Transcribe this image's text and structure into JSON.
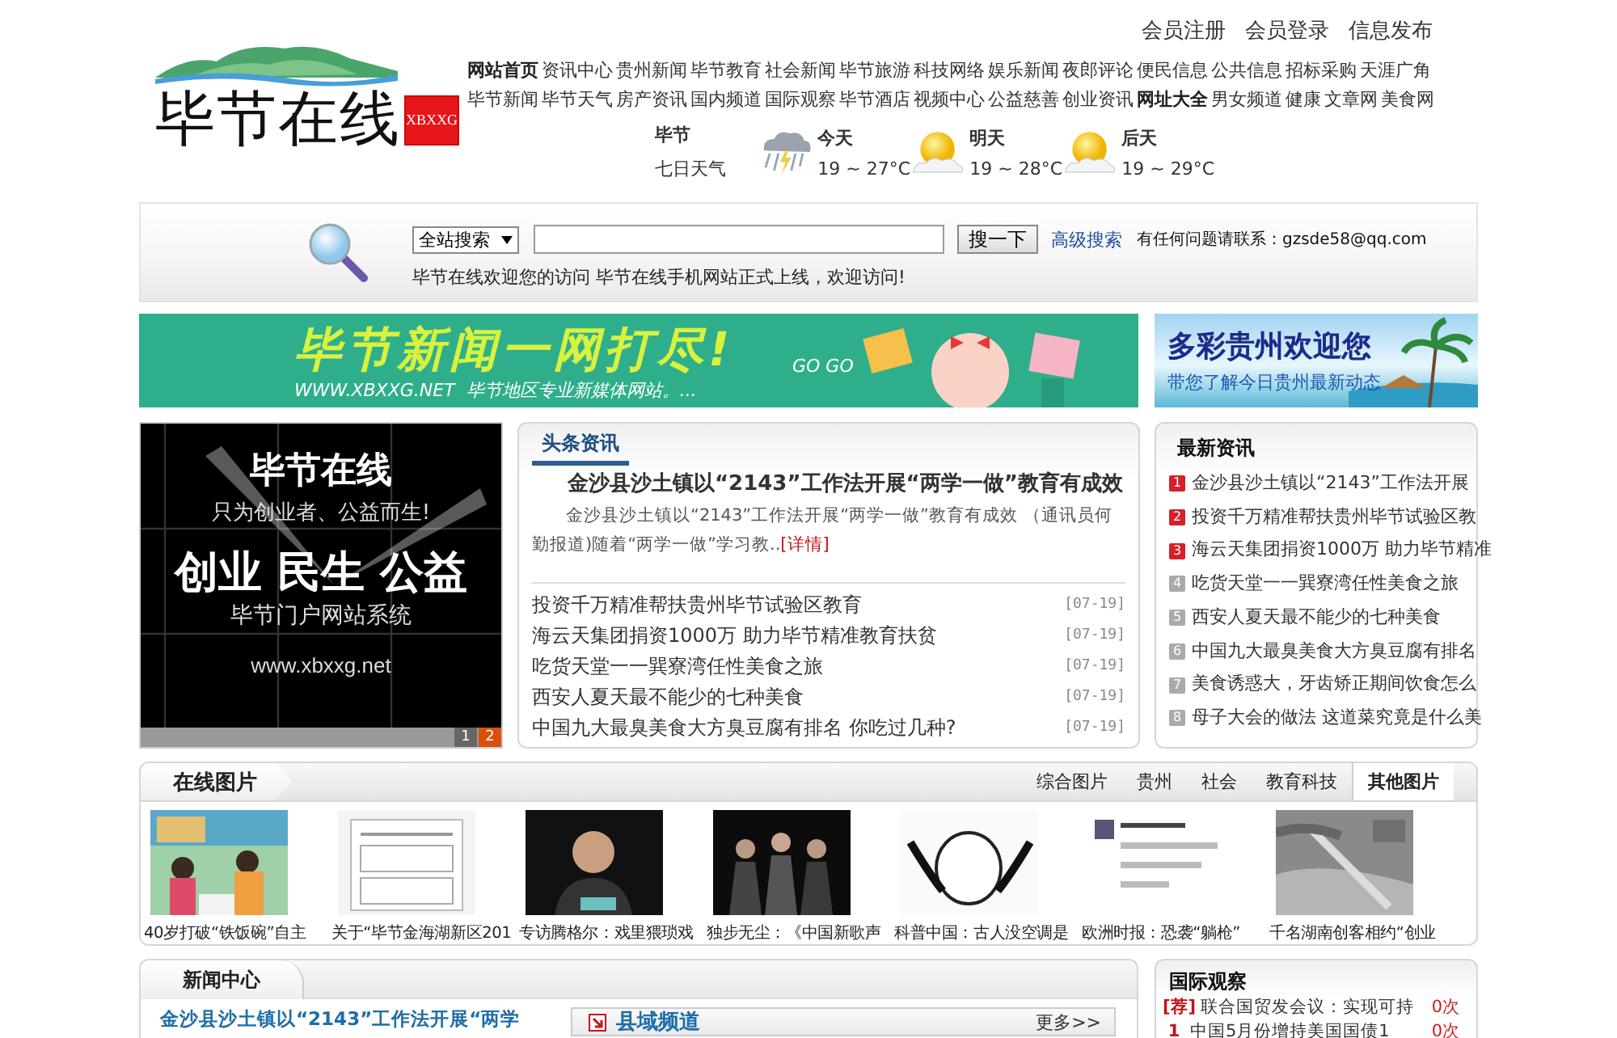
{
  "header": {
    "logo": {
      "title": "毕节在线",
      "badge": "XBXXG"
    },
    "user_links": [
      "会员注册",
      "会员登录",
      "信息发布"
    ],
    "nav_rows": [
      {
        "items": [
          {
            "label": "网站首页",
            "emphasized": true
          },
          {
            "label": "资讯中心",
            "emphasized": false
          },
          {
            "label": "贵州新闻",
            "emphasized": false
          },
          {
            "label": "毕节教育",
            "emphasized": false
          },
          {
            "label": "社会新闻",
            "emphasized": false
          },
          {
            "label": "毕节旅游",
            "emphasized": false
          },
          {
            "label": "科技网络",
            "emphasized": false
          },
          {
            "label": "娱乐新闻",
            "emphasized": false
          },
          {
            "label": "夜郎评论",
            "emphasized": false
          },
          {
            "label": "便民信息",
            "emphasized": false
          },
          {
            "label": "公共信息",
            "emphasized": false
          },
          {
            "label": "招标采购",
            "emphasized": false
          },
          {
            "label": "天涯广角",
            "emphasized": false
          }
        ]
      },
      {
        "items": [
          {
            "label": "毕节新闻",
            "emphasized": false
          },
          {
            "label": "毕节天气",
            "emphasized": false
          },
          {
            "label": "房产资讯",
            "emphasized": false
          },
          {
            "label": "国内频道",
            "emphasized": false
          },
          {
            "label": "国际观察",
            "emphasized": false
          },
          {
            "label": "毕节酒店",
            "emphasized": false
          },
          {
            "label": "视频中心",
            "emphasized": false
          },
          {
            "label": "公益慈善",
            "emphasized": false
          },
          {
            "label": "创业资讯",
            "emphasized": false
          },
          {
            "label": "网址大全",
            "emphasized": true
          },
          {
            "label": "男女频道",
            "emphasized": false
          },
          {
            "label": "健康",
            "emphasized": false
          },
          {
            "label": "文章网",
            "emphasized": false
          },
          {
            "label": "美食网",
            "emphasized": false
          }
        ]
      }
    ],
    "weather": {
      "city": "毕节",
      "link": "七日天气",
      "days": [
        {
          "label": "今天",
          "temp": "19 ~ 27°C",
          "kind": "storm"
        },
        {
          "label": "明天",
          "temp": "19 ~ 28°C",
          "kind": "sunny"
        },
        {
          "label": "后天",
          "temp": "19 ~ 29°C",
          "kind": "sunny"
        }
      ]
    }
  },
  "search": {
    "scope": "全站搜索",
    "button": "搜一下",
    "advanced": "高级搜索",
    "contact": "有任何问题请联系：gzsde58@qq.com",
    "welcome": "毕节在线欢迎您的访问 毕节在线手机网站正式上线，欢迎访问!"
  },
  "banners": [
    {
      "title": "毕节新闻一网打尽!",
      "subtitle": "WWW.XBXXG.NET  毕节地区专业新媒体网站。...",
      "extra": "GO GO"
    },
    {
      "title": "多彩贵州欢迎您",
      "subtitle": "带您了解今日贵州最新动态"
    }
  ],
  "slider": {
    "title": "毕节在线",
    "slogan": "只为创业者、公益而生!",
    "headline": "创业 民生 公益",
    "subtitle": "毕节门户网站系统",
    "url": "www.xbxxg.net",
    "pages": [
      {
        "label": "1",
        "selected": false
      },
      {
        "label": "2",
        "selected": true
      }
    ]
  },
  "headlines": {
    "title": "头条资讯",
    "lead_title": "金沙县沙土镇以“2143”工作法开展“两学一做”教育有成效",
    "lead_summary": "金沙县沙土镇以“2143”工作法开展“两学一做”教育有成效 （通讯员何勤报道)随着“两学一做”学习教..",
    "more": "[详情]",
    "items": [
      {
        "title": "投资千万精准帮扶贵州毕节试验区教育",
        "date": "[07-19]"
      },
      {
        "title": "海云天集团捐资1000万 助力毕节精准教育扶贫",
        "date": "[07-19]"
      },
      {
        "title": "吃货天堂一一巽寮湾任性美食之旅",
        "date": "[07-19]"
      },
      {
        "title": "西安人夏天最不能少的七种美食",
        "date": "[07-19]"
      },
      {
        "title": "中国九大最臭美食大方臭豆腐有排名 你吃过几种?",
        "date": "[07-19]"
      }
    ]
  },
  "latest": {
    "title": "最新资讯",
    "items": [
      {
        "rank": "1",
        "hot": true,
        "title": "金沙县沙土镇以“2143”工作法开展"
      },
      {
        "rank": "2",
        "hot": true,
        "title": "投资千万精准帮扶贵州毕节试验区教"
      },
      {
        "rank": "3",
        "hot": true,
        "title": "海云天集团捐资1000万 助力毕节精准"
      },
      {
        "rank": "4",
        "hot": false,
        "title": "吃货天堂一一巽寮湾任性美食之旅"
      },
      {
        "rank": "5",
        "hot": false,
        "title": "西安人夏天最不能少的七种美食"
      },
      {
        "rank": "6",
        "hot": false,
        "title": "中国九大最臭美食大方臭豆腐有排名"
      },
      {
        "rank": "7",
        "hot": false,
        "title": "美食诱惑大，牙齿矫正期间饮食怎么"
      },
      {
        "rank": "8",
        "hot": false,
        "title": "母子大会的做法 这道菜究竟是什么美"
      }
    ]
  },
  "photos": {
    "title": "在线图片",
    "tabs": [
      {
        "label": "综合图片",
        "selected": false
      },
      {
        "label": "贵州",
        "selected": false
      },
      {
        "label": "社会",
        "selected": false
      },
      {
        "label": "教育科技",
        "selected": false
      },
      {
        "label": "其他图片",
        "selected": true
      }
    ],
    "items": [
      {
        "caption": "40岁打破“铁饭碗”自主"
      },
      {
        "caption": "关于“毕节金海湖新区201"
      },
      {
        "caption": "专访腾格尔：戏里猥琐戏"
      },
      {
        "caption": "独步无尘：《中国新歌声"
      },
      {
        "caption": "科普中国：古人没空调是"
      },
      {
        "caption": "欧洲时报：恐袭“躺枪”"
      },
      {
        "caption": "千名湖南创客相约“创业"
      }
    ]
  },
  "news_center": {
    "title": "新闻中心",
    "lead": "金沙县沙土镇以“2143”工作法开展“两学",
    "channel": {
      "title": "县域频道",
      "more": "更多>>"
    }
  },
  "intl": {
    "title": "国际观察",
    "items": [
      {
        "tag": "[荐]",
        "title": "联合国贸发会议：实现可持",
        "count": "0次"
      },
      {
        "tag": "1",
        "title": "中国5月份增持美国国债1",
        "count": "0次"
      }
    ]
  }
}
